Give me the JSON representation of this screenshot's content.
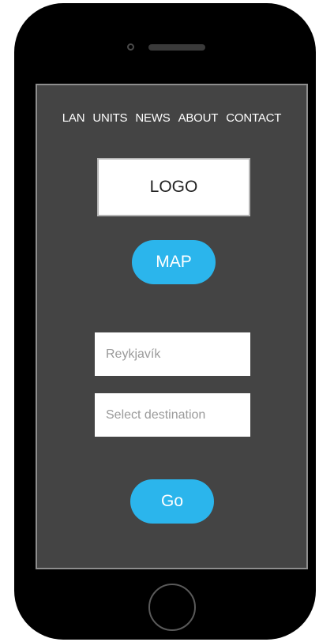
{
  "nav": {
    "items": [
      {
        "label": "LAN"
      },
      {
        "label": "UNITS"
      },
      {
        "label": "NEWS"
      },
      {
        "label": "ABOUT"
      },
      {
        "label": "CONTACT"
      }
    ]
  },
  "logo": {
    "label": "LOGO"
  },
  "map_button": {
    "label": "MAP"
  },
  "origin_field": {
    "value": "Reykjavík"
  },
  "destination_field": {
    "placeholder": "Select destination"
  },
  "go_button": {
    "label": "Go"
  },
  "colors": {
    "accent": "#2bb5ec",
    "screen_background": "#444444",
    "device_body": "#000000"
  }
}
